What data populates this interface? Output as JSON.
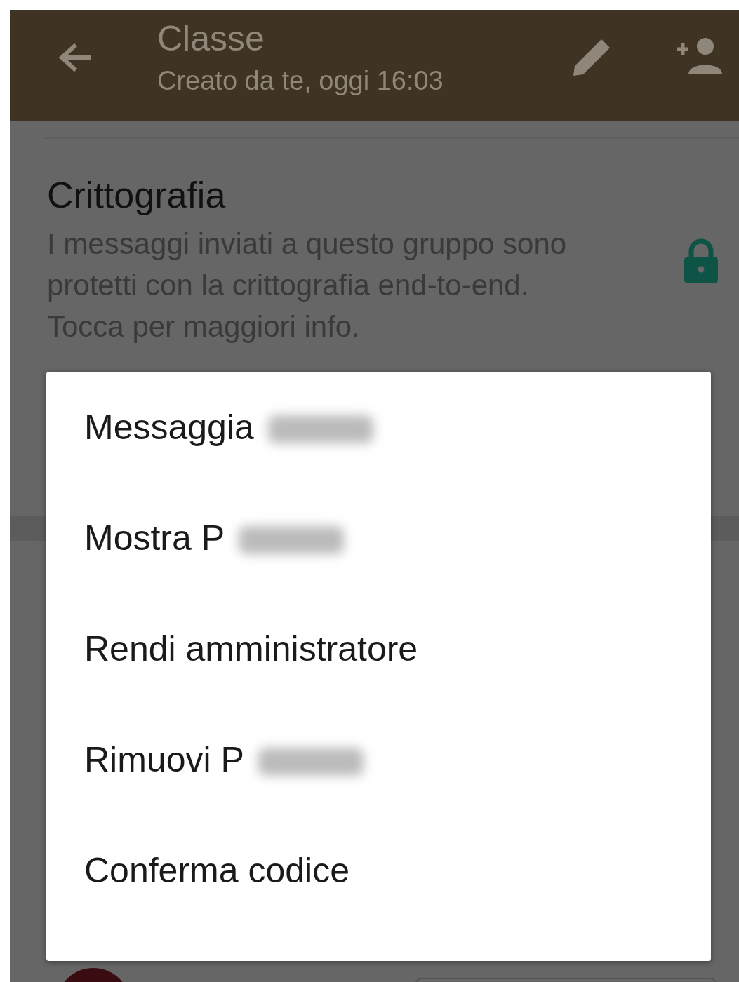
{
  "header": {
    "title": "Classe",
    "subtitle": "Creato da te, oggi 16:03"
  },
  "encryption": {
    "title": "Crittografia",
    "description": "I messaggi inviati a questo gruppo sono protetti con la crittografia end-to-end. Tocca per maggiori info."
  },
  "menu": {
    "items": [
      {
        "label": "Messaggia",
        "redacted": true
      },
      {
        "label": "Mostra P",
        "redacted": true
      },
      {
        "label": "Rendi amministratore",
        "redacted": false
      },
      {
        "label": "Rimuovi P",
        "redacted": true
      },
      {
        "label": "Conferma codice",
        "redacted": false
      }
    ]
  }
}
